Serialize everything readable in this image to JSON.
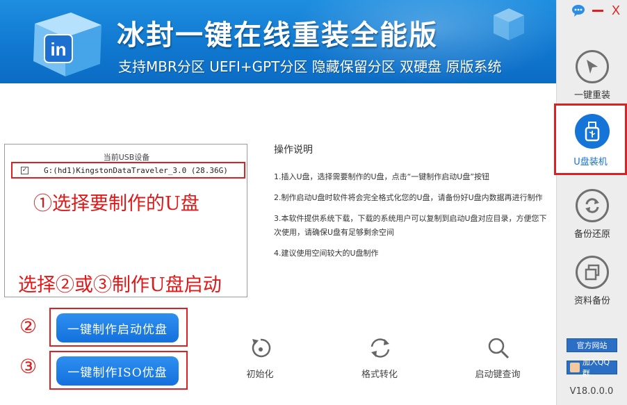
{
  "banner": {
    "title": "冰封一键在线重装全能版",
    "subtitle": "支持MBR分区  UEFI+GPT分区  隐藏保留分区  双硬盘  原版系统",
    "logo_text": "in"
  },
  "sidebar": {
    "items": [
      {
        "label": "一键重装",
        "icon": "cursor-arrow-icon"
      },
      {
        "label": "U盘装机",
        "icon": "usb-drive-icon",
        "active": true
      },
      {
        "label": "备份还原",
        "icon": "refresh-arrows-icon"
      },
      {
        "label": "资料备份",
        "icon": "copy-squares-icon"
      }
    ],
    "official_site": "官方网站",
    "qq_group": "加入QQ群",
    "version": "V18.0.0.0"
  },
  "window_controls": {
    "chat": "chat-bubble-icon",
    "minimize": "minimize-icon",
    "close": "X"
  },
  "device_panel": {
    "header": "当前USB设备",
    "device": "G:(hd1)KingstonDataTraveler_3.0 (28.36G)",
    "checked": true
  },
  "annotations": {
    "step1": "①选择要制作的U盘",
    "choose": "选择②或③制作U盘启动",
    "num2": "②",
    "num3": "③"
  },
  "instructions": {
    "title": "操作说明",
    "steps": [
      "1.插入U盘，选择需要制作的U盘，点击“一键制作启动U盘”按钮",
      "2.制作启动U盘时软件将会完全格式化您的U盘，请备份好U盘内数据再进行制作",
      "3.本软件提供系统下载，下载的系统用户可以复制到启动U盘对应目录，方便您下次使用，请确保U盘有足够剩余空间",
      "4.建议使用空间较大的U盘制作"
    ]
  },
  "buttons": {
    "make_boot_usb": "一键制作启动优盘",
    "make_iso_usb": "一键制作ISO优盘"
  },
  "tools": [
    {
      "label": "初始化",
      "icon": "reset-icon"
    },
    {
      "label": "格式转化",
      "icon": "convert-arrows-icon"
    },
    {
      "label": "启动键查询",
      "icon": "magnifier-icon"
    }
  ],
  "colors": {
    "accent": "#1474d8",
    "annotation": "#e02020",
    "banner": "#1078d0"
  }
}
